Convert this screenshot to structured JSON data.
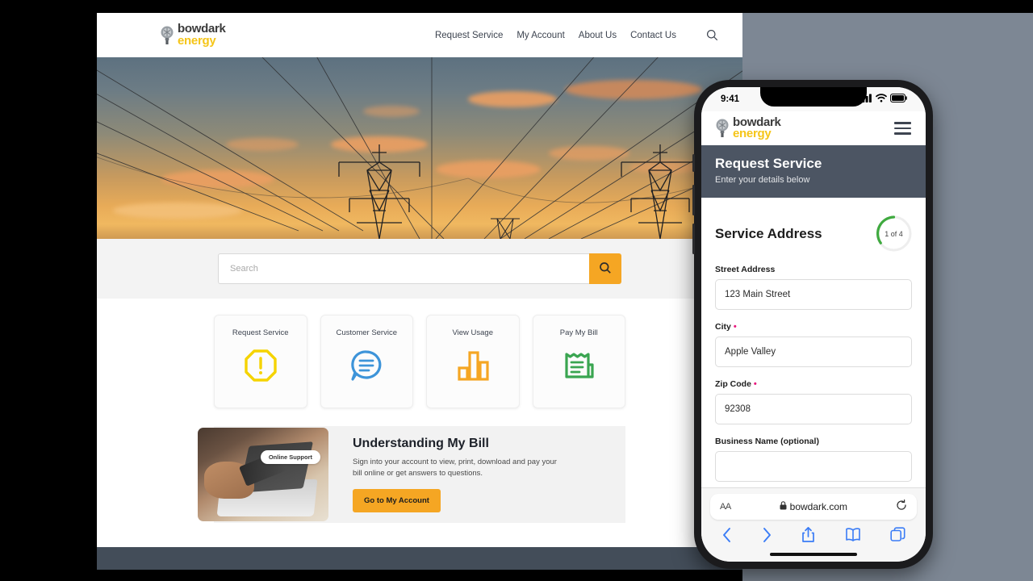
{
  "colors": {
    "brand_yellow": "#f5c518",
    "accent_orange": "#f5a623",
    "slate": "#434d59",
    "banner_slate": "#4c5563",
    "grey_panel": "#7d8794",
    "required_pink": "#e8197d",
    "progress_green": "#3faa3f",
    "safari_blue": "#3a7cf6"
  },
  "desktop": {
    "logo": {
      "top": "bowdark",
      "bottom": "energy",
      "icon": "lightbulb-icon"
    },
    "nav": [
      {
        "label": "Request Service"
      },
      {
        "label": "My Account"
      },
      {
        "label": "About Us"
      },
      {
        "label": "Contact Us"
      }
    ],
    "search_icon": "search-icon",
    "hero": {
      "alt": "power-transmission-towers-at-sunset"
    },
    "search": {
      "placeholder": "Search",
      "value": "",
      "button_icon": "search-icon"
    },
    "cards": [
      {
        "label": "Request Service",
        "icon": "octagon-alert-icon",
        "color": "#f5d300"
      },
      {
        "label": "Customer Service",
        "icon": "chat-bubble-icon",
        "color": "#3d94d9"
      },
      {
        "label": "View Usage",
        "icon": "bar-chart-icon",
        "color": "#f5a623"
      },
      {
        "label": "Pay My Bill",
        "icon": "bill-receipt-icon",
        "color": "#3aa551"
      }
    ],
    "promo": {
      "badge": "Online Support",
      "title": "Understanding My Bill",
      "body": "Sign into your account to view, print, download and pay your bill online or get answers to questions.",
      "button": "Go to My Account",
      "image_alt": "hands-holding-credit-card-at-laptop"
    }
  },
  "phone": {
    "status": {
      "time": "9:41",
      "cellular_icon": "signal-bars-icon",
      "wifi_icon": "wifi-icon",
      "battery_icon": "battery-icon"
    },
    "logo": {
      "top": "bowdark",
      "bottom": "energy",
      "icon": "lightbulb-icon"
    },
    "menu_icon": "hamburger-menu-icon",
    "banner": {
      "title": "Request Service",
      "subtitle": "Enter your details below"
    },
    "section": {
      "title": "Service Address",
      "progress_label": "1 of 4",
      "progress_step": 1,
      "progress_total": 4
    },
    "fields": [
      {
        "label": "Street Address",
        "required": false,
        "value": "123 Main Street"
      },
      {
        "label": "City",
        "required": true,
        "value": "Apple Valley"
      },
      {
        "label": "Zip Code",
        "required": true,
        "value": "92308"
      },
      {
        "label": "Business Name (optional)",
        "required": false,
        "value": ""
      }
    ],
    "safari": {
      "text_size_label": "AA",
      "lock_icon": "lock-icon",
      "url": "bowdark.com",
      "reload_icon": "reload-icon",
      "nav": [
        {
          "icon": "back-chevron-icon"
        },
        {
          "icon": "forward-chevron-icon"
        },
        {
          "icon": "share-icon"
        },
        {
          "icon": "bookmarks-icon"
        },
        {
          "icon": "tabs-icon"
        }
      ]
    }
  }
}
